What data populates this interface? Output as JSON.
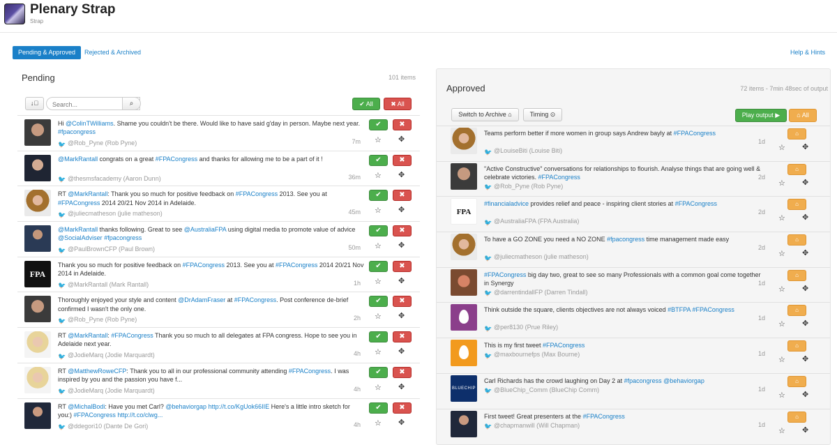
{
  "header": {
    "title": "Plenary Strap",
    "subtitle": "Strap"
  },
  "tabs": {
    "active": "Pending & Approved",
    "other": "Rejected & Archived",
    "help": "Help & Hints"
  },
  "pending": {
    "title": "Pending",
    "count": "101 items",
    "sort_icon": "↓⃒",
    "search_placeholder": "Search...",
    "all_accept": "✔ All",
    "all_reject": "✖ All",
    "items": [
      {
        "text_html": "Hi <span class='at'>@ColinTWilliams</span>. Shame you couldn't be there. Would like to have said g'day in person. Maybe next year. <span class='tag'>#fpacongress</span>",
        "user": "@Rob_Pyne (Rob Pyne)",
        "age": "7m",
        "avatar": "av-man1"
      },
      {
        "text_html": "<span class='at'>@MarkRantall</span> congrats on a great <span class='tag'>#FPACongress</span> and thanks for allowing me to be a part of it !",
        "user": "@thesmsfacademy (Aaron Dunn)",
        "age": "36m",
        "avatar": "av-man2"
      },
      {
        "text_html": "RT <span class='at'>@MarkRantall</span>: Thank you so much for positive feedback on <span class='tag'>#FPACongress</span> 2013. See you at <span class='tag'>#FPACongress</span> 2014 20/21 Nov 2014 in Adelaide.",
        "user": "@juliecmatheson (julie matheson)",
        "age": "45m",
        "avatar": "av-woman"
      },
      {
        "text_html": "<span class='at'>@MarkRantall</span> thanks following. Great to see <span class='at'>@AustraliaFPA</span> using digital media to promote value of advice <span class='at'>@SocialAdviser</span> <span class='tag'>#fpacongress</span>",
        "user": "@PaulBrownCFP (Paul Brown)",
        "age": "50m",
        "avatar": "av-man3"
      },
      {
        "text_html": "Thank you so much for positive feedback on <span class='tag'>#FPACongress</span> 2013. See you at <span class='tag'>#FPACongress</span> 2014 20/21 Nov 2014 in Adelaide.",
        "user": "@MarkRantall (Mark Rantall)",
        "age": "1h",
        "avatar": "av-fpa"
      },
      {
        "text_html": "Thoroughly enjoyed your style and content <span class='at'>@DrAdamFraser</span> at <span class='tag'>#FPACongress</span>. Post conference de-brief confirmed I wasn't the only one.",
        "user": "@Rob_Pyne (Rob Pyne)",
        "age": "2h",
        "avatar": "av-man1"
      },
      {
        "text_html": "RT <span class='at'>@MarkRantall</span>: <span class='tag'>#FPACongress</span> Thank you so much to all delegates at FPA congress. Hope to see you in Adelaide next year.",
        "user": "@JodieMarq (Jodie Marquardt)",
        "age": "4h",
        "avatar": "av-blonde"
      },
      {
        "text_html": "RT <span class='at'>@MatthewRoweCFP</span>: Thank you to all in our professional community attending <span class='tag'>#FPACongress</span>. I was inspired by you and the passion you have f...",
        "user": "@JodieMarq (Jodie Marquardt)",
        "age": "4h",
        "avatar": "av-blonde"
      },
      {
        "text_html": "RT <span class='at'>@MichalBodi</span>: Have you met Carl? <span class='at'>@behaviorgap</span> <span class='at'>http://t.co/KgUok66IIE</span> Here's a little intro sketch for you:) <span class='tag'>#FPACongress</span> <span class='at'>http://t.co/clwg...</span>",
        "user": "@ddegori10 (Dante De Gori)",
        "age": "4h",
        "avatar": "av-suit"
      }
    ]
  },
  "approved": {
    "title": "Approved",
    "count": "72 items - 7min 48sec of output",
    "switch_label": "Switch to Archive ⌂",
    "timing_label": "Timing ⊙",
    "play_label": "Play output ▶",
    "all_label": "⌂ All",
    "items": [
      {
        "text_html": "Teams perform better if more women in group says Andrew bayly at <span class='tag'>#FPACongress</span>",
        "user": "@LouiseBiti (Louise Biti)",
        "age": "1d",
        "avatar": "av-woman"
      },
      {
        "text_html": "\"Active Constructive\" conversations for relationships to flourish. Analyse things that are going well &amp; celebrate victories. <span class='tag'>#FPACongress</span>",
        "user": "@Rob_Pyne (Rob Pyne)",
        "age": "2d",
        "avatar": "av-man1"
      },
      {
        "text_html": "<span class='tag'>#financialadvice</span> provides relief and peace - inspiring client stories at <span class='tag'>#FPACongress</span>",
        "user": "@AustraliaFPA (FPA Australia)",
        "age": "2d",
        "avatar": "av-fpa-w"
      },
      {
        "text_html": "To have a GO ZONE you need a NO ZONE <span class='tag'>#fpacongress</span> time management made easy",
        "user": "@juliecmatheson (julie matheson)",
        "age": "2d",
        "avatar": "av-woman"
      },
      {
        "text_html": "<span class='tag'>#FPACongress</span> big day two, great to see so many Professionals with a common goal come together in Synergy",
        "user": "@darrentindallFP (Darren Tindall)",
        "age": "1d",
        "avatar": "av-red"
      },
      {
        "text_html": "Think outside the square, clients objectives are not always voiced <span class='tag'>#BTFPA</span> <span class='tag'>#FPACongress</span>",
        "user": "@per8130 (Prue Riley)",
        "age": "1d",
        "avatar": "av-egg-purple"
      },
      {
        "text_html": "This is my first tweet <span class='tag'>#FPACongress</span>",
        "user": "@maxbournefps (Max Bourne)",
        "age": "1d",
        "avatar": "av-egg-orange"
      },
      {
        "text_html": "Carl Richards has the crowd laughing on Day 2 at <span class='tag'>#fpacongress</span> <span class='at'>@behaviorgap</span>",
        "user": "@BlueChip_Comm (BlueChip Comm)",
        "age": "1d",
        "avatar": "av-bluechip"
      },
      {
        "text_html": "First tweet! Great presenters at the <span class='tag'>#FPACongress</span>",
        "user": "@chapmanwill (Will Chapman)",
        "age": "1d",
        "avatar": "av-suit"
      }
    ]
  }
}
